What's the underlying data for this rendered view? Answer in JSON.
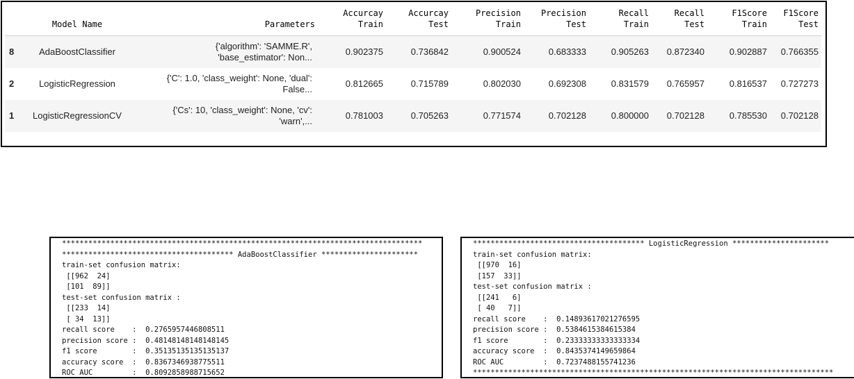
{
  "results_table": {
    "headers": [
      {
        "key": "index",
        "label": ""
      },
      {
        "key": "model_name",
        "label": "Model Name"
      },
      {
        "key": "parameters",
        "label": "Parameters"
      },
      {
        "key": "acc_train",
        "label1": "Accurcay",
        "label2": "Train"
      },
      {
        "key": "acc_test",
        "label1": "Accurcay",
        "label2": "Test"
      },
      {
        "key": "prec_train",
        "label1": "Precision",
        "label2": "Train"
      },
      {
        "key": "prec_test",
        "label1": "Precision",
        "label2": "Test"
      },
      {
        "key": "rec_train",
        "label1": "Recall",
        "label2": "Train"
      },
      {
        "key": "rec_test",
        "label1": "Recall",
        "label2": "Test"
      },
      {
        "key": "f1_train",
        "label1": "F1Score",
        "label2": "Train"
      },
      {
        "key": "f1_test",
        "label1": "F1Score",
        "label2": "Test"
      }
    ],
    "rows": [
      {
        "index": "8",
        "model_name": "AdaBoostClassifier",
        "params_line1": "{'algorithm': 'SAMME.R',",
        "params_line2": "'base_estimator': Non...",
        "acc_train": "0.902375",
        "acc_test": "0.736842",
        "prec_train": "0.900524",
        "prec_test": "0.683333",
        "rec_train": "0.905263",
        "rec_test": "0.872340",
        "f1_train": "0.902887",
        "f1_test": "0.766355"
      },
      {
        "index": "2",
        "model_name": "LogisticRegression",
        "params_line1": "{'C': 1.0, 'class_weight': None, 'dual':",
        "params_line2": "False...",
        "acc_train": "0.812665",
        "acc_test": "0.715789",
        "prec_train": "0.802030",
        "prec_test": "0.692308",
        "rec_train": "0.831579",
        "rec_test": "0.765957",
        "f1_train": "0.816537",
        "f1_test": "0.727273"
      },
      {
        "index": "1",
        "model_name": "LogisticRegressionCV",
        "params_line1": "{'Cs': 10, 'class_weight': None, 'cv':",
        "params_line2": "'warn',...",
        "acc_train": "0.781003",
        "acc_test": "0.705263",
        "prec_train": "0.771574",
        "prec_test": "0.702128",
        "rec_train": "0.800000",
        "rec_test": "0.702128",
        "f1_train": "0.785530",
        "f1_test": "0.702128"
      }
    ]
  },
  "console_left": {
    "lines": [
      "**********************************************************************************",
      "*************************************** AdaBoostClassifier **********************",
      "train-set confusion matrix:",
      " [[962  24]",
      " [101  89]]",
      "test-set confusion matrix :",
      " [[233  14]",
      " [ 34  13]]",
      "recall score    :  0.2765957446808511",
      "precision score :  0.48148148148148145",
      "f1 score        :  0.35135135135135137",
      "accuracy score  :  0.8367346938775511",
      "ROC AUC         :  0.8092858988715652",
      "**********************************************************************************"
    ]
  },
  "console_right": {
    "lines": [
      "*************************************** LogisticRegression **********************",
      "train-set confusion matrix:",
      " [[970  16]",
      " [157  33]]",
      "test-set confusion matrix :",
      " [[241   6]",
      " [ 40   7]]",
      "recall score    :  0.14893617021276595",
      "precision score :  0.5384615384615384",
      "f1 score        :  0.23333333333333334",
      "accuracy score  :  0.8435374149659864",
      "ROC AUC         :  0.7237488155741236",
      "**********************************************************************************"
    ]
  }
}
